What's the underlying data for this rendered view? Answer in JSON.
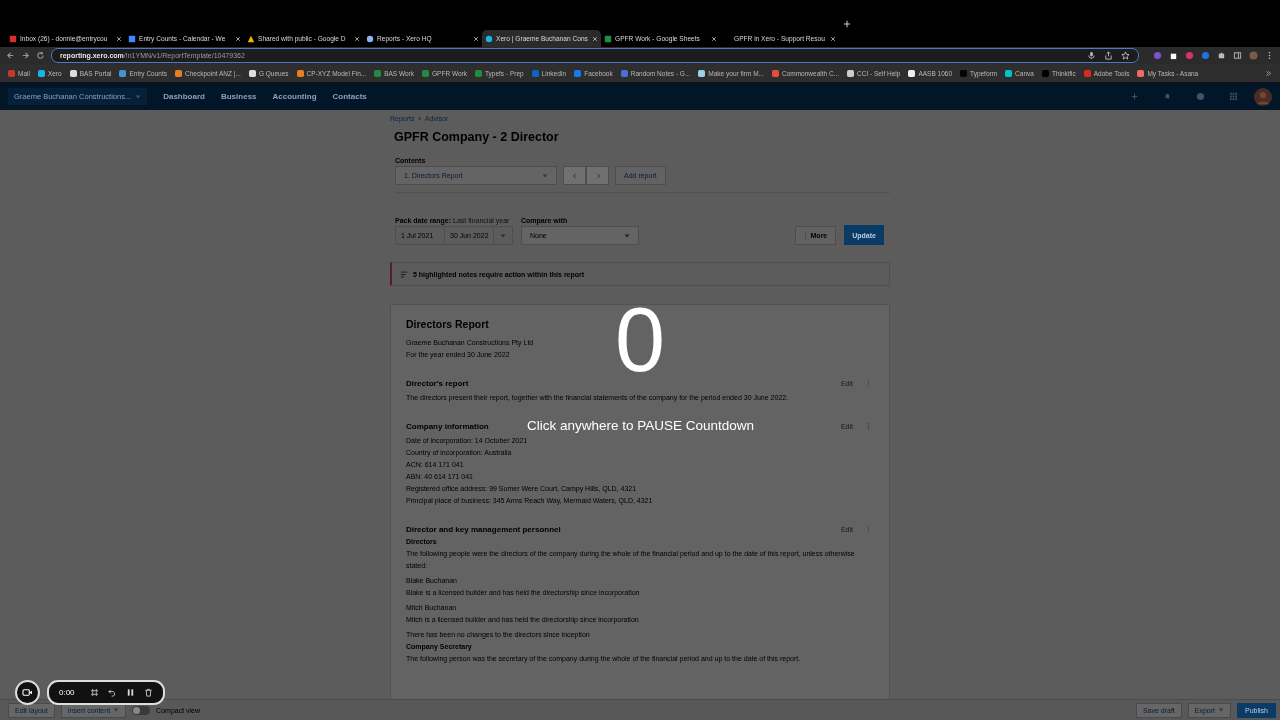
{
  "browser": {
    "tabs": [
      {
        "title": "Inbox (26) - donnie@entrycou",
        "kind": "mail",
        "selected": false
      },
      {
        "title": "Entry Counts - Calendar - We",
        "kind": "calendar",
        "selected": false
      },
      {
        "title": "Shared with public - Google D",
        "kind": "drive",
        "selected": false
      },
      {
        "title": "Reports - Xero HQ",
        "kind": "globe",
        "selected": false
      },
      {
        "title": "Xero | Graeme Buchanan Cons",
        "kind": "xero",
        "selected": true
      },
      {
        "title": "GPFR Work - Google Sheets",
        "kind": "sheet",
        "selected": false
      },
      {
        "title": "GPFR in Xero - Support Resou",
        "kind": "none",
        "selected": false
      }
    ],
    "address": "**reporting.xero.com**/!n1YMN/v1/ReportTemplate/10479362",
    "bookmarks": [
      {
        "label": "Mail",
        "color": "#c0392b"
      },
      {
        "label": "Xero",
        "color": "#13b5ea"
      },
      {
        "label": "BAS Portal",
        "color": "#dddddd"
      },
      {
        "label": "Entry Counts",
        "color": "#4a90d9"
      },
      {
        "label": "Checkpoint ANZ |...",
        "color": "#e67e22"
      },
      {
        "label": "G Queues",
        "color": "#dddddd"
      },
      {
        "label": "CP-XYZ Model Fin...",
        "color": "#e67e22"
      },
      {
        "label": "BAS Work",
        "color": "#1e8e3e"
      },
      {
        "label": "GPFR Work",
        "color": "#1e8e3e"
      },
      {
        "label": "Typefs - Prep",
        "color": "#1e8e3e"
      },
      {
        "label": "LinkedIn",
        "color": "#0a66c2"
      },
      {
        "label": "Facebook",
        "color": "#1877f2"
      },
      {
        "label": "Random Notes - G...",
        "color": "#4a6fd9"
      },
      {
        "label": "Make your firm M...",
        "color": "#9ad0e8"
      },
      {
        "label": "Commonwealth C...",
        "color": "#e74c3c"
      },
      {
        "label": "CCI - Self Help",
        "color": "#cccccc"
      },
      {
        "label": "AASB 1060",
        "color": "#eeeeee"
      },
      {
        "label": "Typeform",
        "color": "#050505"
      },
      {
        "label": "Canva",
        "color": "#00c4cc"
      },
      {
        "label": "Thinkific",
        "color": "#000000"
      },
      {
        "label": "Adobe Tools",
        "color": "#e1251b"
      },
      {
        "label": "My Tasks - Asana",
        "color": "#f06a6a"
      }
    ]
  },
  "app_nav": {
    "organisation": "Graeme Buchanan Constructions...",
    "items": [
      "Dashboard",
      "Business",
      "Accounting",
      "Contacts"
    ]
  },
  "breadcrumb": {
    "items": [
      "Reports",
      "Advisor"
    ],
    "separator": "›"
  },
  "title": "GPFR Company - 2 Director",
  "contents": {
    "label": "Contents",
    "value": "1. Directors Report",
    "add": "Add report"
  },
  "date_range": {
    "label": "Pack date range:",
    "hint": "Last financial year",
    "from": "1 Jul 2021",
    "to": "30 Jun 2022"
  },
  "compare": {
    "label": "Compare with",
    "value": "None"
  },
  "actions": {
    "more": "More",
    "update": "Update"
  },
  "notice": "5 highlighted notes require action within this report",
  "report": {
    "title": "Directors Report",
    "lines": [
      "Graeme Buchanan Constructions Pty Ltd",
      "For the year ended 30 June 2022"
    ],
    "sections": [
      {
        "title": "Director's report",
        "edit": "Edit",
        "lines": [
          {
            "kind": "text",
            "text": "The directors present their report, together with the financial statements of the company for the period ended 30 June 2022."
          }
        ]
      },
      {
        "title": "Company information",
        "edit": "Edit",
        "lines": [
          {
            "kind": "text",
            "text": "Date of incorporation: 14 October 2021"
          },
          {
            "kind": "text",
            "text": "Country of incorporation: Australia"
          },
          {
            "kind": "text",
            "text": "ACN: 614 171 041"
          },
          {
            "kind": "text",
            "text": "ABN: 40 614 171 041"
          },
          {
            "kind": "text",
            "text": "Registered office address: 99 Somer Were Court, Campy Hills, QLD, 4321"
          },
          {
            "kind": "text",
            "text": "Principal place of business: 345 Arms Reach Way, Mermaid Waters, QLD, 4321"
          }
        ]
      },
      {
        "title": "Director and key management personnel",
        "edit": "Edit",
        "lines": [
          {
            "kind": "subhead",
            "text": "Directors"
          },
          {
            "kind": "para",
            "text": "The following people were the directors of the company during the whole of the financial period and up to the date of this report, unless otherwise stated:"
          },
          {
            "kind": "para",
            "text": "Blake Buchanan"
          },
          {
            "kind": "text",
            "text": "Blake is a licensed builder and has held the directorship since incorporation"
          },
          {
            "kind": "para",
            "text": "Mitch Buchanan"
          },
          {
            "kind": "text",
            "text": "Mitch is a licensed builder and has held the directorship since incorporation"
          },
          {
            "kind": "para",
            "text": "There has been no changes to the directors since inception"
          },
          {
            "kind": "subhead",
            "text": "Company Secretary"
          },
          {
            "kind": "para",
            "text": "The following person was the secretary of the company during the whole of the financial period and up to the date of this report."
          }
        ]
      }
    ]
  },
  "countdown": {
    "number": "0",
    "message": "Click anywhere to PAUSE Countdown"
  },
  "recorder": {
    "time": "0:00"
  },
  "footer": {
    "edit_layout": "Edit layout",
    "insert": "Insert content",
    "compact": {
      "label": "Compact view",
      "on": false
    },
    "save": "Save draft",
    "export": "Export",
    "publish": "Publish"
  }
}
